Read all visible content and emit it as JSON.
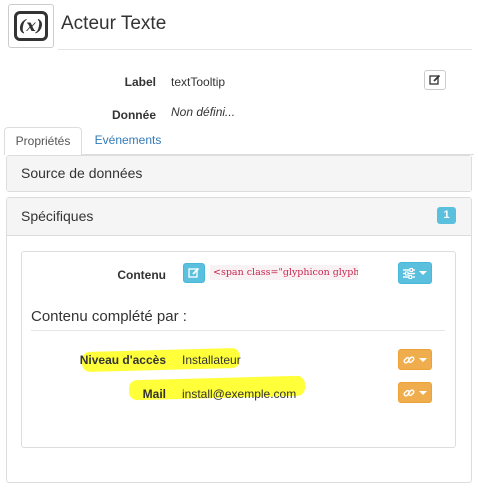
{
  "header": {
    "icon": "variable-icon",
    "icon_text": "(x)",
    "title": "Acteur Texte"
  },
  "properties": {
    "label_caption": "Label",
    "label_value": "textTooltip",
    "data_caption": "Donnée",
    "data_value": "Non défini..."
  },
  "tabs": [
    {
      "label": "Propriétés",
      "active": true
    },
    {
      "label": "Evénements",
      "active": false
    }
  ],
  "panels": {
    "source": {
      "title": "Source de données"
    },
    "specifics": {
      "title": "Spécifiques",
      "badge": "1"
    }
  },
  "content": {
    "caption": "Contenu",
    "value": "<span class=\"glyphicon glyphi..."
  },
  "completed_by": {
    "heading": "Contenu complété par :",
    "rows": [
      {
        "caption": "Niveau d'accès",
        "value": "Installateur"
      },
      {
        "caption": "Mail",
        "value": "install@exemple.com"
      }
    ]
  },
  "colors": {
    "info": "#5bc0de",
    "warning": "#f0ad4e",
    "link": "#337ab7",
    "highlight": "#ffff3a"
  }
}
